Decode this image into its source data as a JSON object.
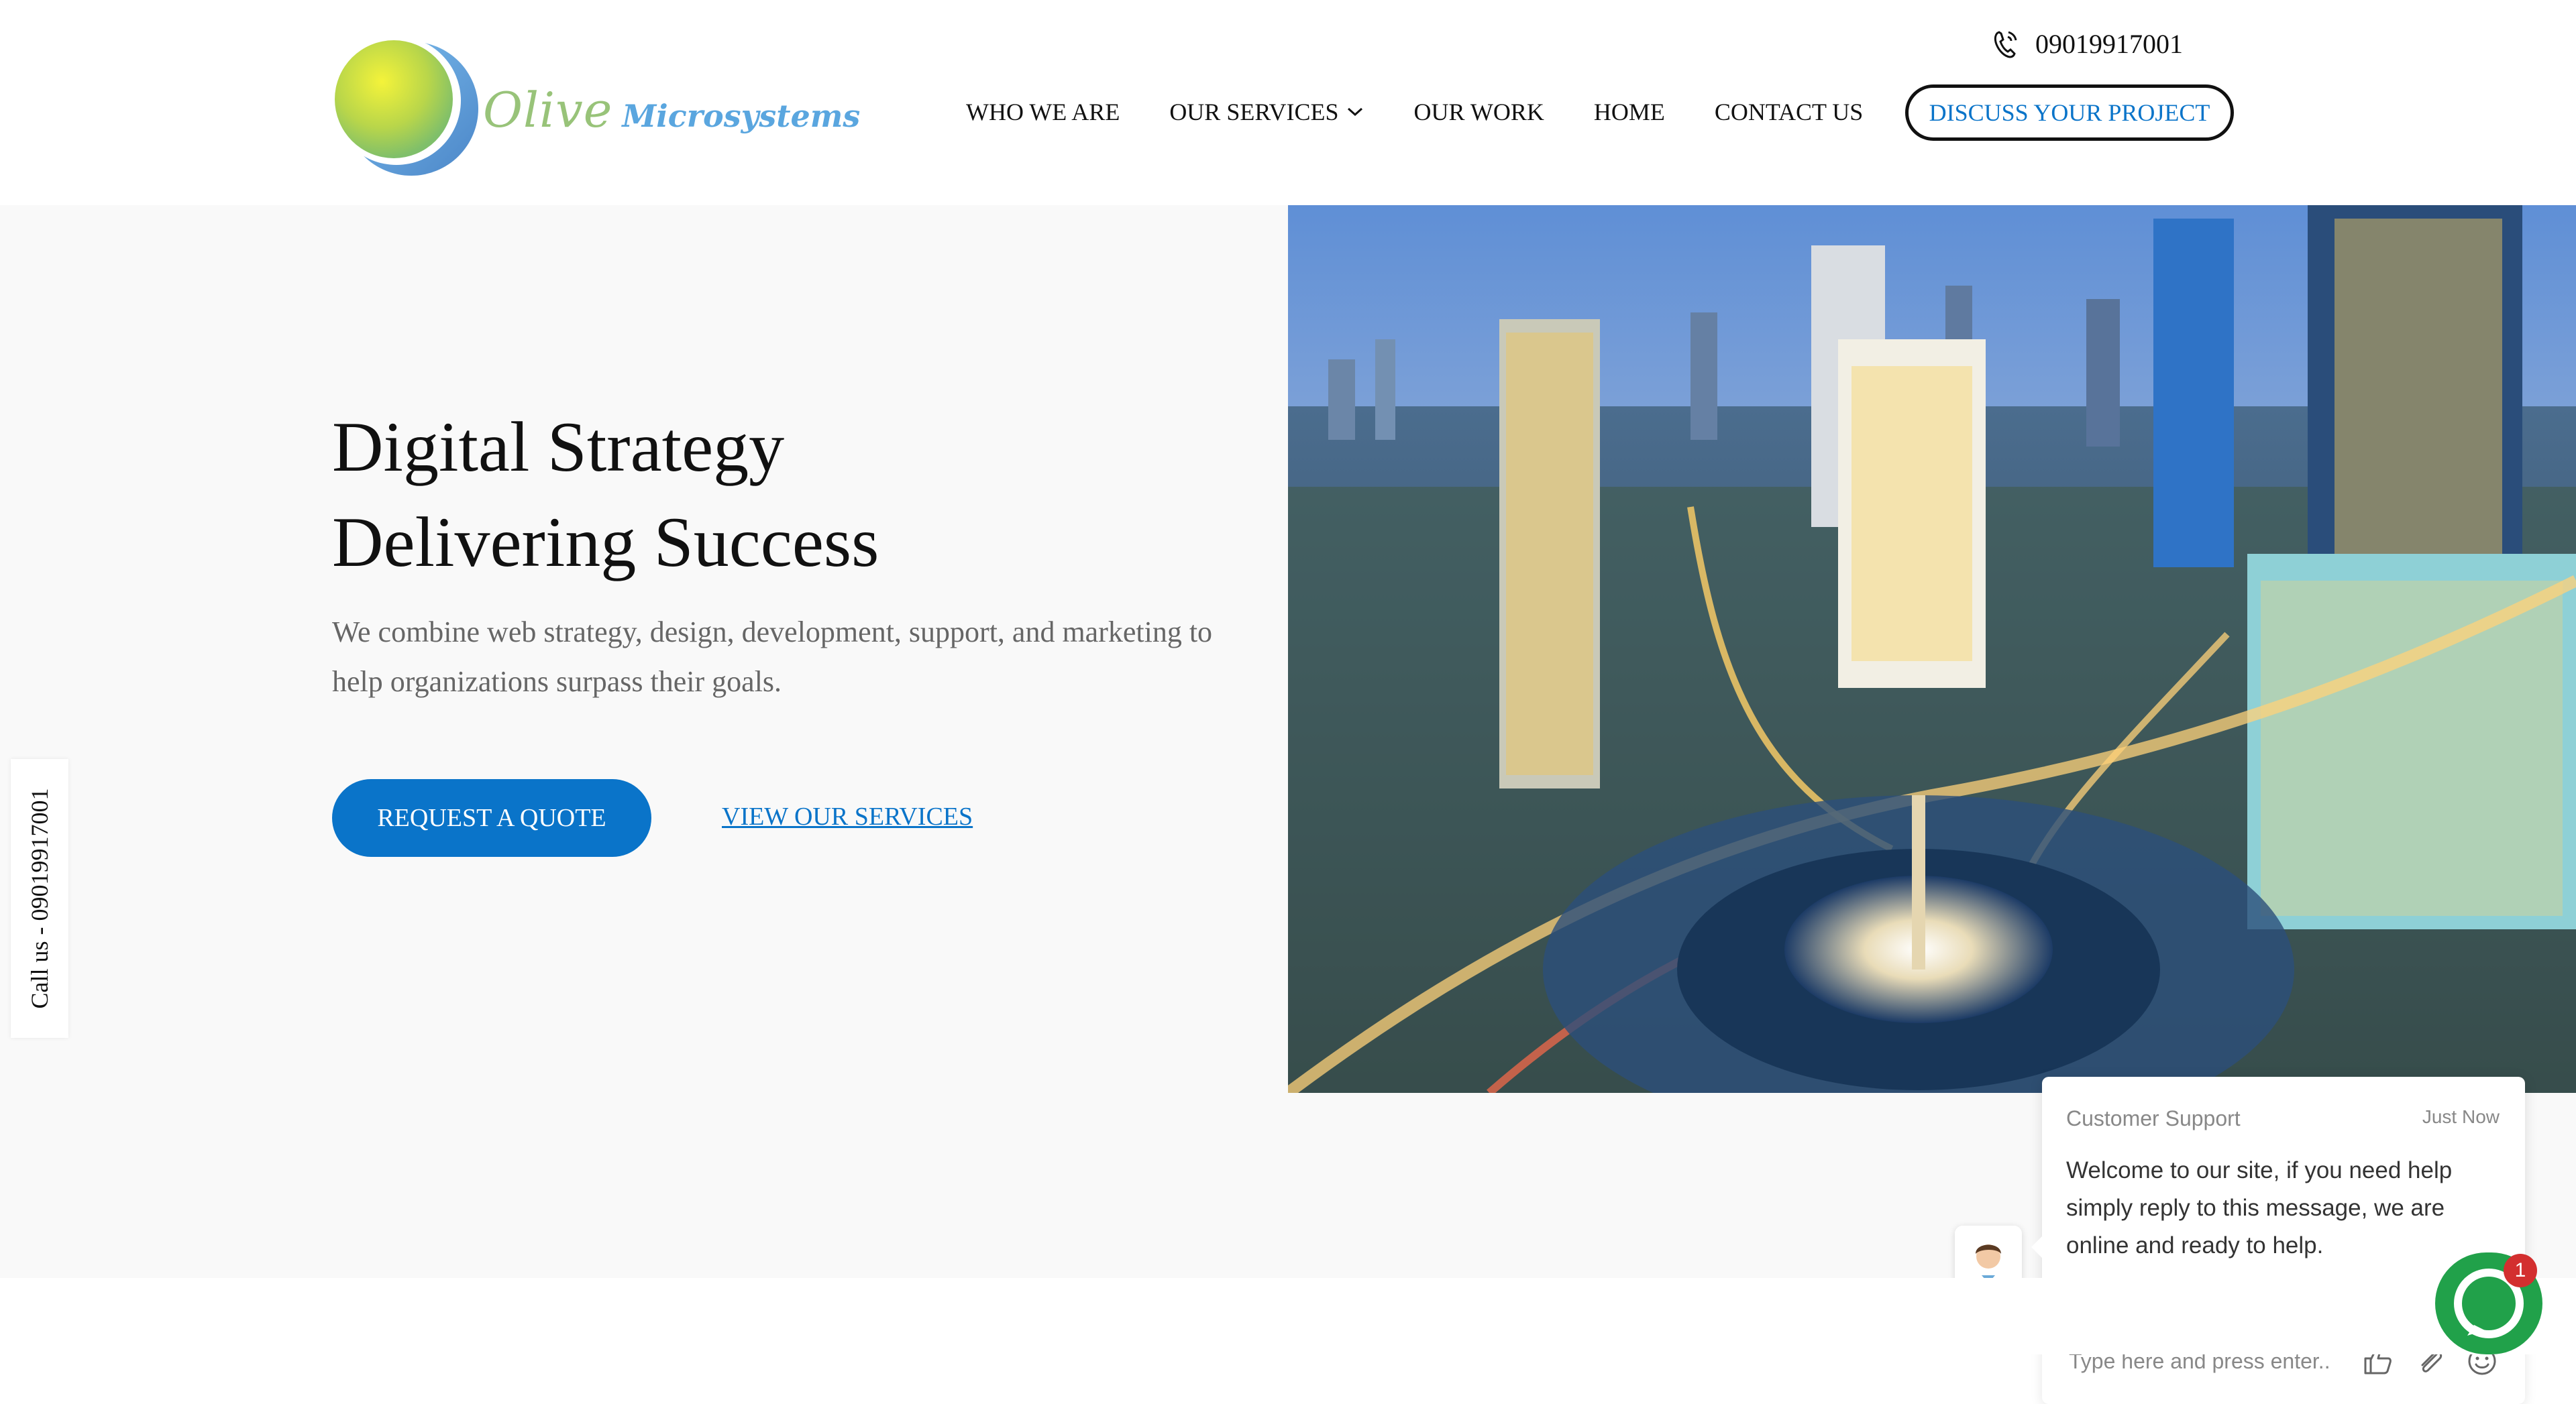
{
  "brand": {
    "name_part1": "Olive",
    "name_part2": "Microsystems"
  },
  "header": {
    "phone": "09019917001",
    "nav": [
      "WHO WE ARE",
      "OUR SERVICES",
      "OUR WORK",
      "HOME",
      "CONTACT US"
    ],
    "cta": "DISCUSS YOUR PROJECT"
  },
  "hero": {
    "title_line1": "Digital Strategy",
    "title_line2": "Delivering Success",
    "description": "We combine web strategy, design, development, support, and marketing to help organizations surpass their goals.",
    "primary_button": "REQUEST A QUOTE",
    "secondary_link": "VIEW OUR SERVICES"
  },
  "side_tab": {
    "label": "Call us - 09019917001"
  },
  "chat": {
    "agent": "Customer Support",
    "time": "Just Now",
    "message": "Welcome to our site, if you need help simply reply to this message, we are online and ready to help.",
    "input_placeholder": "Type here and press enter..",
    "unread_count": "1"
  },
  "colors": {
    "accent": "#0a74c9",
    "chat_green": "#21a14a",
    "badge_red": "#d32f2f",
    "logo_green": "#98c379",
    "logo_blue": "#5aa6df"
  }
}
